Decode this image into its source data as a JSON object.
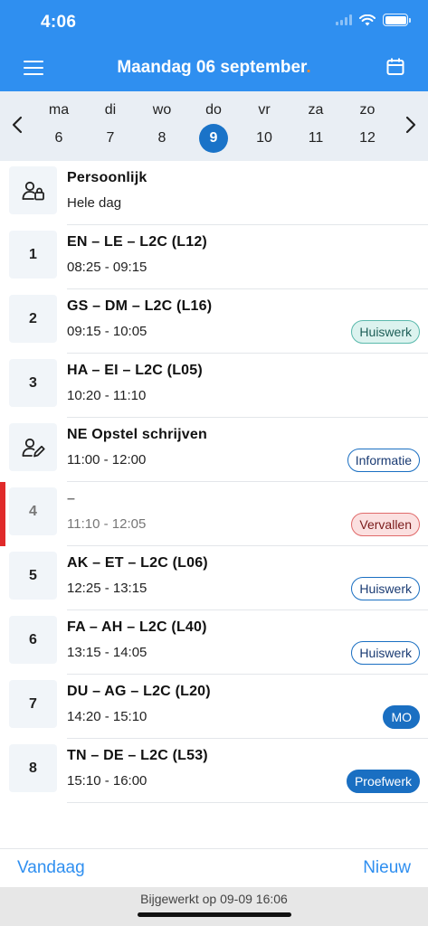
{
  "status": {
    "time": "4:06"
  },
  "header": {
    "title": "Maandag 06 september",
    "dot": "."
  },
  "week": {
    "days": [
      {
        "name": "ma",
        "num": "6"
      },
      {
        "name": "di",
        "num": "7"
      },
      {
        "name": "wo",
        "num": "8"
      },
      {
        "name": "do",
        "num": "9",
        "active": true
      },
      {
        "name": "vr",
        "num": "10"
      },
      {
        "name": "za",
        "num": "11"
      },
      {
        "name": "zo",
        "num": "12"
      }
    ]
  },
  "rows": [
    {
      "badge": "",
      "icon": "person-lock-icon",
      "title": "Persoonlijk",
      "time": "Hele dag",
      "tag": ""
    },
    {
      "badge": "1",
      "title": "EN – LE – L2C (L12)",
      "time": "08:25 - 09:15",
      "tag": ""
    },
    {
      "badge": "2",
      "title": "GS – DM – L2C (L16)",
      "time": "09:15 - 10:05",
      "tag": "Huiswerk"
    },
    {
      "badge": "3",
      "title": "HA – EI – L2C (L05)",
      "time": "10:20 - 11:10",
      "tag": ""
    },
    {
      "badge": "",
      "icon": "person-edit-icon",
      "title": "NE Opstel schrijven",
      "time": "11:00 - 12:00",
      "tag": "Informatie"
    },
    {
      "badge": "4",
      "title": "–",
      "time": "11:10 - 12:05",
      "tag": "Vervallen"
    },
    {
      "badge": "5",
      "title": "AK – ET – L2C (L06)",
      "time": "12:25 - 13:15",
      "tag": "Huiswerk"
    },
    {
      "badge": "6",
      "title": "FA – AH – L2C (L40)",
      "time": "13:15 - 14:05",
      "tag": "Huiswerk"
    },
    {
      "badge": "7",
      "title": "DU – AG – L2C (L20)",
      "time": "14:20 - 15:10",
      "tag": "MO"
    },
    {
      "badge": "8",
      "title": "TN – DE – L2C (L53)",
      "time": "15:10 - 16:00",
      "tag": "Proefwerk"
    }
  ],
  "bottom": {
    "today": "Vandaag",
    "new": "Nieuw"
  },
  "updated": "Bijgewerkt op 09-09 16:06",
  "colors": {
    "header": "#2f8ff0",
    "accent": "#1a73c8",
    "cancelled": "#e02a2a"
  }
}
